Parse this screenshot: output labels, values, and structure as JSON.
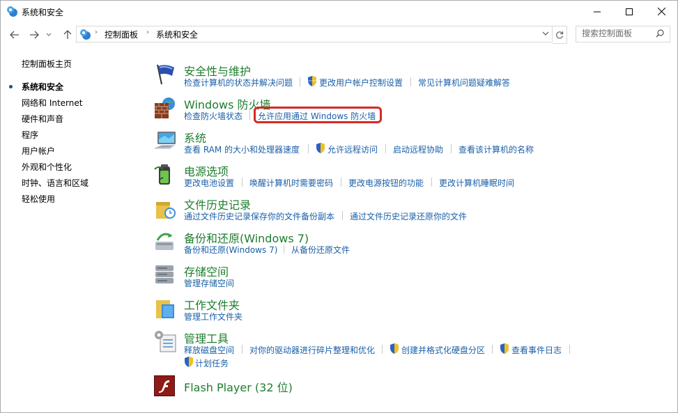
{
  "window": {
    "title": "系统和安全",
    "controls": [
      "minimize-icon",
      "maximize-icon",
      "close-icon"
    ]
  },
  "nav": {
    "back": "back-arrow-icon",
    "forward": "forward-arrow-icon",
    "recent": "chevron-down-icon",
    "up": "up-arrow-icon",
    "breadcrumbs": [
      "控制面板",
      "系统和安全"
    ],
    "refresh": "refresh-icon"
  },
  "search": {
    "placeholder": "搜索控制面板"
  },
  "sidebar": {
    "home": "控制面板主页",
    "items": [
      {
        "label": "系统和安全",
        "active": true
      },
      {
        "label": "网络和 Internet"
      },
      {
        "label": "硬件和声音"
      },
      {
        "label": "程序"
      },
      {
        "label": "用户帐户"
      },
      {
        "label": "外观和个性化"
      },
      {
        "label": "时钟、语言和区域"
      },
      {
        "label": "轻松使用"
      }
    ]
  },
  "categories": [
    {
      "title": "安全性与维护",
      "icon": "security-flag-icon",
      "links": [
        "检查计算机的状态并解决问题",
        "更改用户帐户控制设置",
        "常见计算机问题疑难解答"
      ]
    },
    {
      "title": "Windows 防火墙",
      "icon": "firewall-icon",
      "links": [
        "检查防火墙状态",
        "允许应用通过 Windows 防火墙"
      ]
    },
    {
      "title": "系统",
      "icon": "system-computer-icon",
      "links": [
        "查看 RAM 的大小和处理器速度",
        "允许远程访问",
        "启动远程协助",
        "查看该计算机的名称"
      ]
    },
    {
      "title": "电源选项",
      "icon": "power-battery-icon",
      "links": [
        "更改电池设置",
        "唤醒计算机时需要密码",
        "更改电源按钮的功能",
        "更改计算机睡眠时间"
      ]
    },
    {
      "title": "文件历史记录",
      "icon": "file-history-icon",
      "links": [
        "通过文件历史记录保存你的文件备份副本",
        "通过文件历史记录还原你的文件"
      ]
    },
    {
      "title": "备份和还原(Windows 7)",
      "icon": "backup-restore-icon",
      "links": [
        "备份和还原(Windows 7)",
        "从备份还原文件"
      ]
    },
    {
      "title": "存储空间",
      "icon": "storage-spaces-icon",
      "links": [
        "管理存储空间"
      ]
    },
    {
      "title": "工作文件夹",
      "icon": "work-folders-icon",
      "links": [
        "管理工作文件夹"
      ]
    },
    {
      "title": "管理工具",
      "icon": "admin-tools-icon",
      "links": [
        "释放磁盘空间",
        "对你的驱动器进行碎片整理和优化",
        "创建并格式化硬盘分区",
        "查看事件日志",
        "计划任务"
      ]
    },
    {
      "title": "Flash Player (32 位)",
      "icon": "flash-player-icon",
      "links": []
    }
  ],
  "colors": {
    "title_green": "#1e7d2d",
    "link_blue": "#1a5fa8",
    "highlight_red": "#d42a25"
  }
}
